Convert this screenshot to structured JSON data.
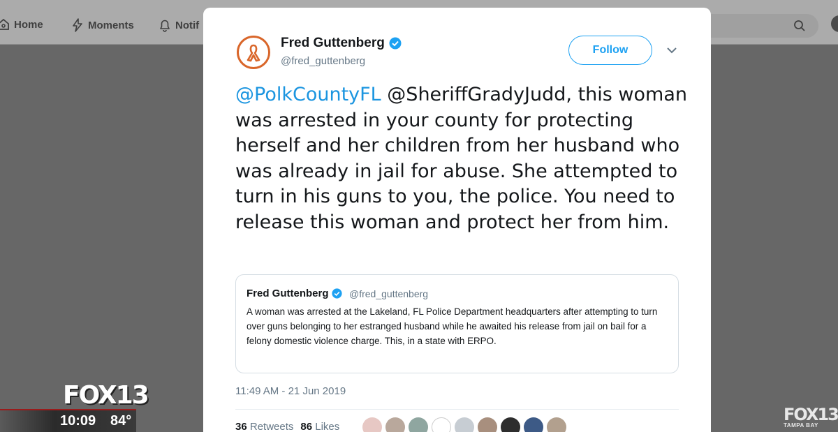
{
  "nav": {
    "home_label": "Home",
    "moments_label": "Moments",
    "notifications_label": "Notif"
  },
  "tweet": {
    "author_name": "Fred Guttenberg",
    "author_handle": "@fred_guttenberg",
    "follow_label": "Follow",
    "mention_1": "@PolkCountyFL",
    "body": " @SheriffGradyJudd, this woman was arrested in your county for protecting herself and her children from her husband who was already in jail for abuse. She attempted to turn in his guns to you, the police.  You need to release this woman and protect her from him.",
    "timestamp": "11:49 AM - 21 Jun 2019",
    "retweets_count": "36",
    "retweets_label": "Retweets",
    "likes_count": "86",
    "likes_label": "Likes"
  },
  "quote": {
    "author_name": "Fred Guttenberg",
    "author_handle": "@fred_guttenberg",
    "text": "A woman was arrested at the Lakeland, FL Police Department headquarters after attempting to turn over guns belonging to her estranged husband while he awaited his release from jail on bail for a felony domestic violence charge.  This, in a state with ERPO."
  },
  "broadcast": {
    "logo": "FOX13",
    "time": "10:09",
    "temperature": "84°",
    "watermark": "FOX13",
    "watermark_sub": "TAMPA BAY"
  },
  "colors": {
    "link": "#1b95e0",
    "follow_border": "#1da1f2",
    "verified": "#1da1f2",
    "ribbon": "#d9662a"
  }
}
